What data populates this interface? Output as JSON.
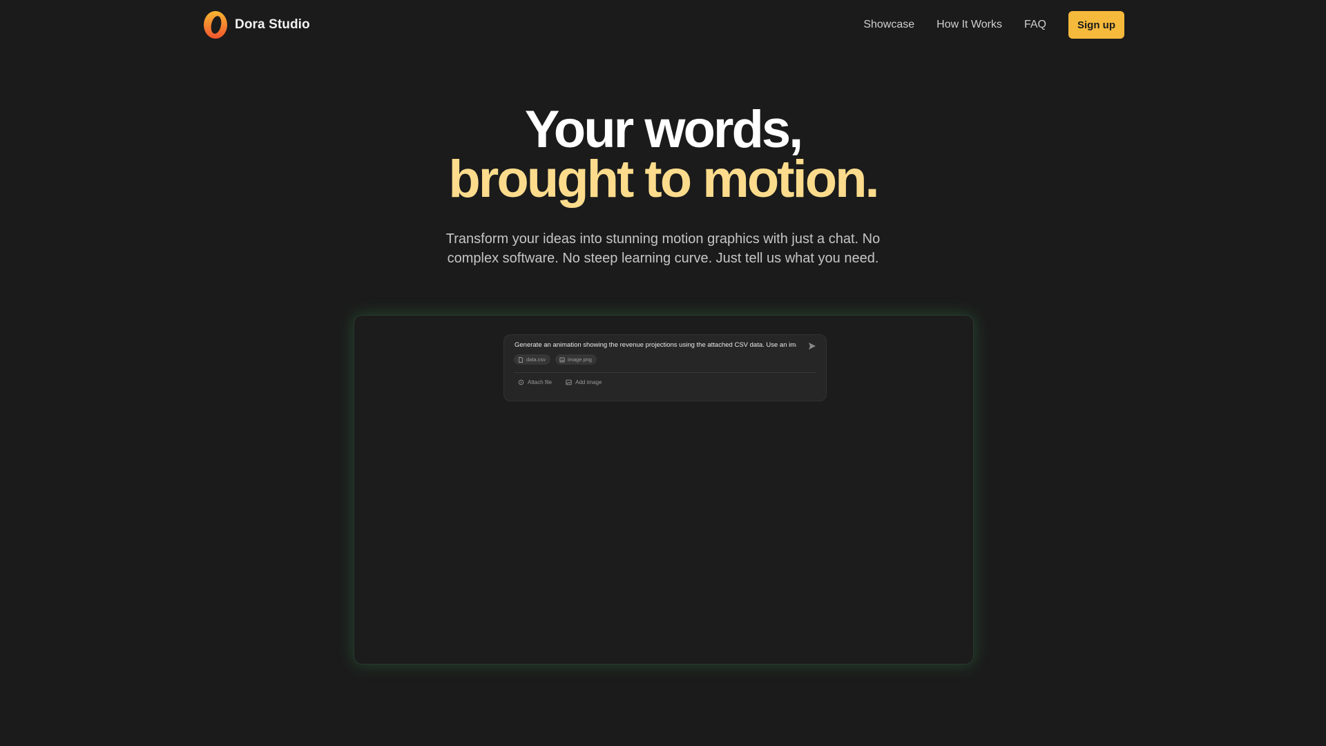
{
  "brand": {
    "name": "Dora Studio",
    "logo_icon": "dora-logo-icon"
  },
  "nav": {
    "items": [
      {
        "label": "Showcase"
      },
      {
        "label": "How It Works"
      },
      {
        "label": "FAQ"
      }
    ],
    "signup_label": "Sign up"
  },
  "hero": {
    "title_line1": "Your words,",
    "title_line2": "brought to motion.",
    "subtitle": "Transform your ideas into stunning motion graphics with just a chat. No complex software. No steep learning curve. Just tell us what you need."
  },
  "demo": {
    "prompt_text": "Generate an animation showing the revenue projections using the attached CSV data. Use an ima",
    "attachments": [
      {
        "label": "data.csv",
        "icon": "file-icon"
      },
      {
        "label": "image.png",
        "icon": "image-icon"
      }
    ],
    "actions": {
      "attach_file": "Attach file",
      "add_image": "Add image"
    }
  },
  "colors": {
    "background": "#1b1b1b",
    "accent": "#f5b93c",
    "headline_accent": "#fcdc8c",
    "panel_glow": "#3ca05a"
  }
}
